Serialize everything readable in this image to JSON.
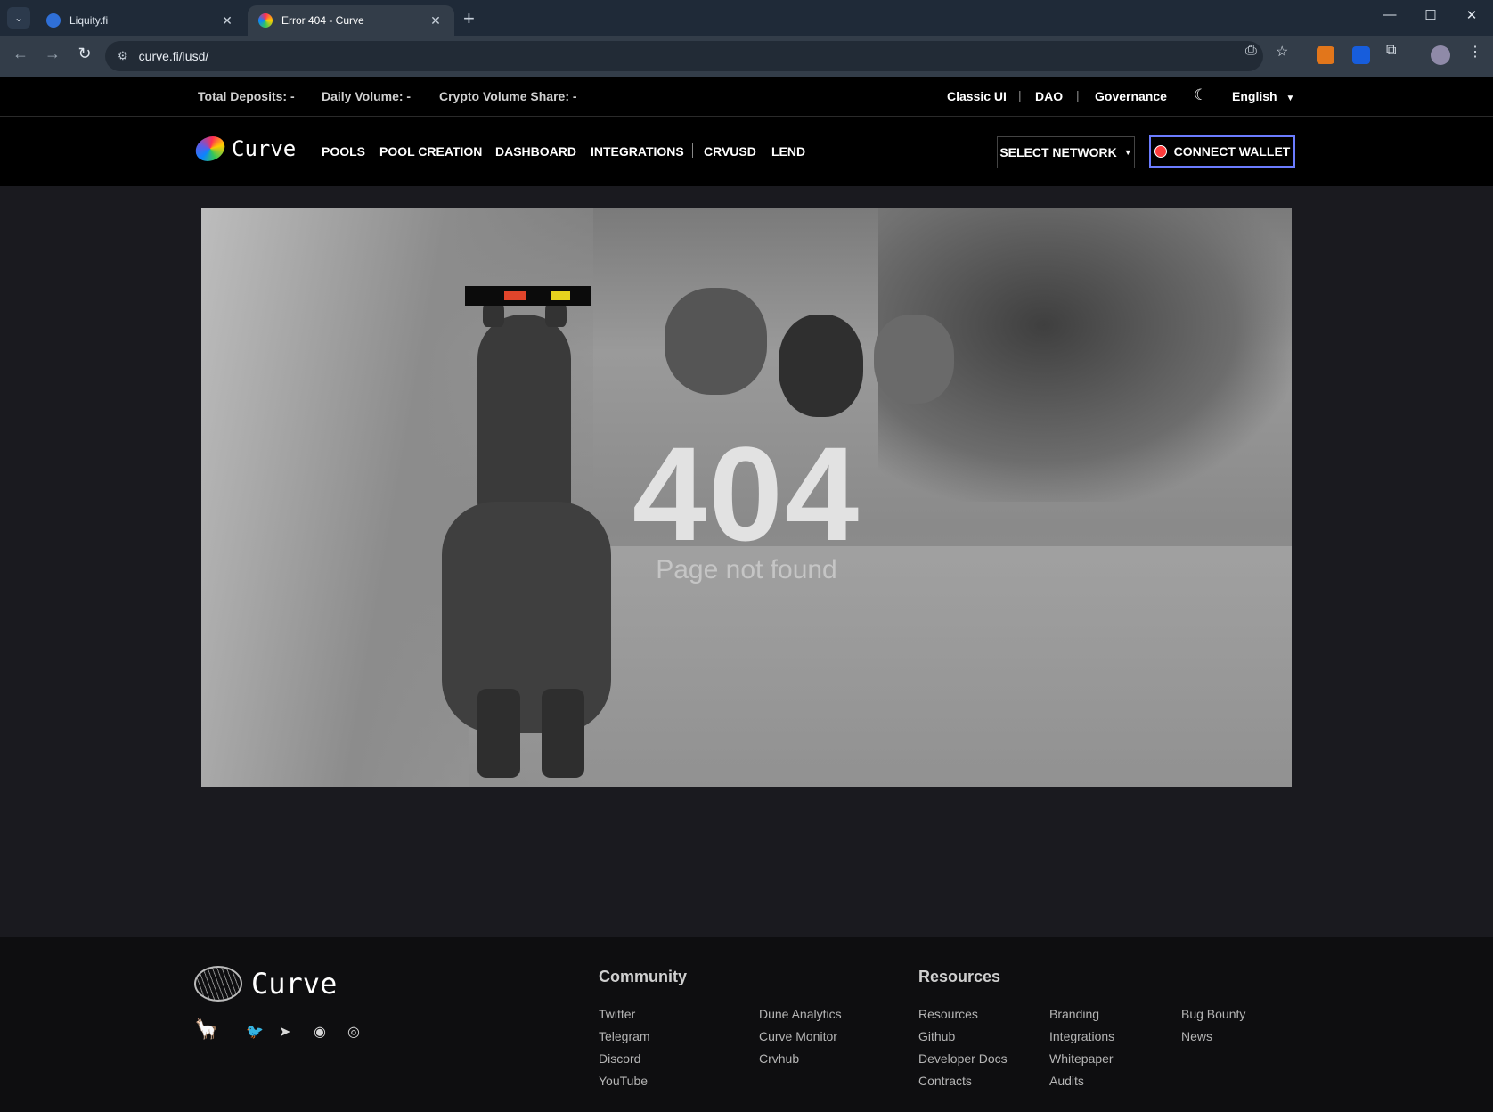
{
  "browser": {
    "tabs": [
      {
        "title": "Liquity.fi",
        "favicon_color": "#2f6fd6"
      },
      {
        "title": "Error 404 - Curve",
        "favicon_color": "#ff9f1c"
      }
    ],
    "url": "curve.fi/lusd/"
  },
  "stats": {
    "total_deposits": "Total Deposits: -",
    "daily_volume": "Daily Volume: -",
    "crypto_volume_share": "Crypto Volume Share: -"
  },
  "top_links": {
    "classic_ui": "Classic UI",
    "dao": "DAO",
    "governance": "Governance",
    "language": "English"
  },
  "nav": {
    "brand": "Curve",
    "links": [
      "POOLS",
      "POOL CREATION",
      "DASHBOARD",
      "INTEGRATIONS",
      "CRVUSD",
      "LEND"
    ],
    "select_network": "SELECT NETWORK",
    "connect_wallet": "CONNECT WALLET"
  },
  "error": {
    "code": "404",
    "message": "Page not found"
  },
  "footer": {
    "brand": "Curve",
    "community_heading": "Community",
    "community_links_col1": [
      "Twitter",
      "Telegram",
      "Discord",
      "YouTube"
    ],
    "community_links_col2": [
      "Dune Analytics",
      "Curve Monitor",
      "Crvhub"
    ],
    "resources_heading": "Resources",
    "resources_col1": [
      "Resources",
      "Github",
      "Developer Docs",
      "Contracts"
    ],
    "resources_col2": [
      "Branding",
      "Integrations",
      "Whitepaper",
      "Audits"
    ],
    "resources_col3": [
      "Bug Bounty",
      "News"
    ]
  }
}
